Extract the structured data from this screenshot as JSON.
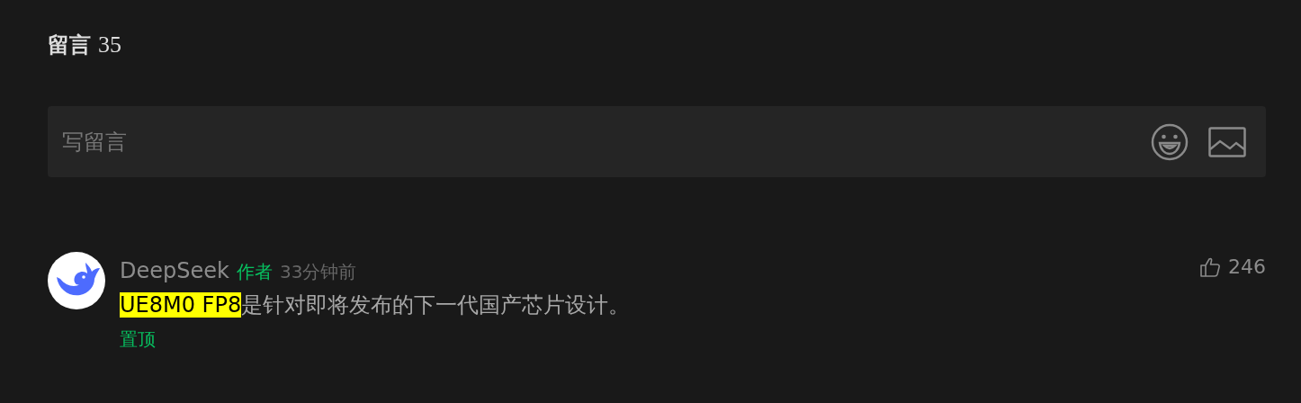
{
  "heading": {
    "title": "留言",
    "count": "35"
  },
  "composer": {
    "placeholder": "写留言"
  },
  "comments": [
    {
      "author": "DeepSeek",
      "badge": "作者",
      "time": "33分钟前",
      "likes": "246",
      "highlight": "UE8M0 FP8",
      "text": "是针对即将发布的下一代国产芯片设计。",
      "pinned_label": "置顶"
    }
  ]
}
